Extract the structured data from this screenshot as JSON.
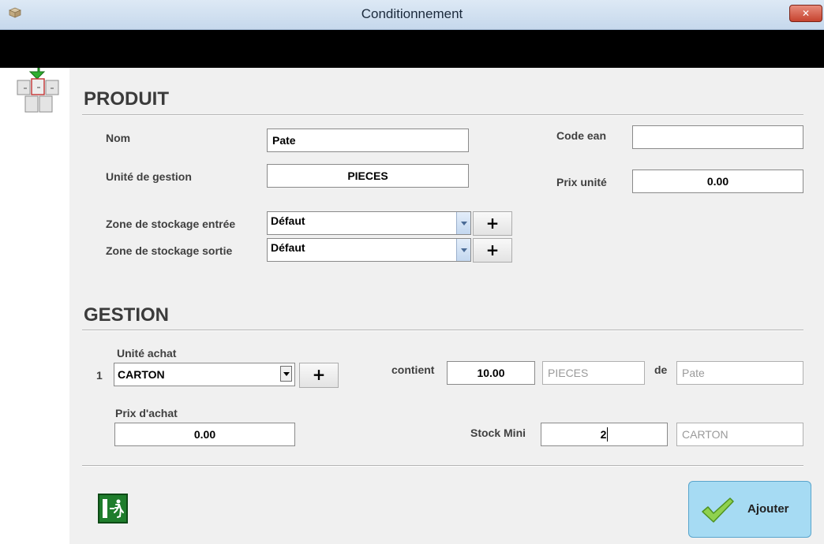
{
  "window": {
    "title": "Conditionnement",
    "close_glyph": "✕",
    "app_icon": "box-icon"
  },
  "toolbar": {
    "icon": "pallet-icon"
  },
  "produit": {
    "heading": "PRODUIT",
    "nom_label": "Nom",
    "nom_value": "Pate",
    "code_ean_label": "Code ean",
    "code_ean_value": "",
    "unite_gestion_label": "Unité de gestion",
    "unite_gestion_value": "PIECES",
    "prix_unite_label": "Prix unité",
    "prix_unite_value": "0.00",
    "zone_entree_label": "Zone de stockage entrée",
    "zone_entree_value": "Défaut",
    "zone_sortie_label": "Zone de stockage sortie",
    "zone_sortie_value": "Défaut",
    "plus_glyph": "+"
  },
  "gestion": {
    "heading": "GESTION",
    "unite_achat_label": "Unité achat",
    "row_index": "1",
    "unite_achat_value": "CARTON",
    "contient_label": "contient",
    "contient_value": "10.00",
    "contient_unit": "PIECES",
    "de_label": "de",
    "de_value": "Pate",
    "prix_achat_label": "Prix d'achat",
    "prix_achat_value": "0.00",
    "stock_mini_label": "Stock Mini",
    "stock_mini_value": "2",
    "stock_mini_unit": "CARTON",
    "plus_glyph": "+"
  },
  "actions": {
    "ajouter_label": "Ajouter",
    "exit_icon": "exit-icon",
    "ajouter_icon": "checkmark-icon"
  },
  "colors": {
    "ajouter_bg": "#a6dbf3",
    "exit_bg": "#1f7d2c",
    "content_bg": "#f0f0f0"
  }
}
